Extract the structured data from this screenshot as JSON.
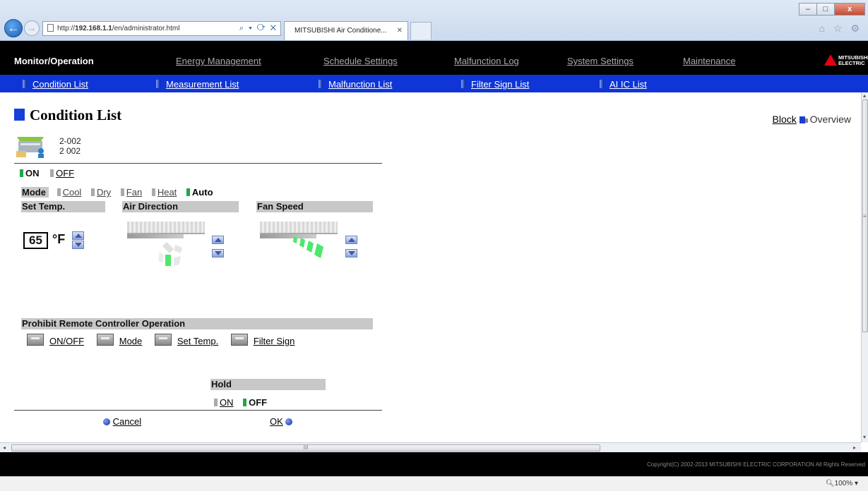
{
  "browser": {
    "url_prefix": "http://",
    "url_host": "192.168.1.1",
    "url_path": "/en/administrator.html",
    "address_tools": "⌕ ▾ ⟳ ✕",
    "tab_title": "MITSUBISHI Air Conditione...",
    "tab_close": "✕",
    "back_glyph": "←",
    "forward_glyph": "→",
    "minimize": "–",
    "maximize": "□",
    "close": "x",
    "right_icons": "⌂ ☆ ⚙",
    "zoom": "100%",
    "zoom_dropdown": "▾"
  },
  "topnav": {
    "monitor": "Monitor/Operation",
    "energy": "Energy Management",
    "schedule": "Schedule Settings",
    "malfunction_log": "Malfunction Log",
    "system": "System Settings",
    "maintenance": "Maintenance",
    "logo_line1": "MITSUBISHI",
    "logo_line2": "ELECTRIC"
  },
  "subnav": {
    "condition": "Condition List",
    "measurement": "Measurement List",
    "malfunction": "Malfunction List",
    "filter": "Filter Sign List",
    "aic": "AI IC List"
  },
  "page": {
    "title": "Condition List",
    "view_block": "Block",
    "view_overview": "Overview",
    "unit_name_1": "2-002",
    "unit_name_2": "2 002"
  },
  "power": {
    "on": "ON",
    "off": "OFF",
    "selected": "ON"
  },
  "mode": {
    "label": "Mode",
    "options": [
      "Cool",
      "Dry",
      "Fan",
      "Heat",
      "Auto"
    ],
    "selected": "Auto"
  },
  "sections": {
    "set_temp": "Set Temp.",
    "air_direction": "Air Direction",
    "fan_speed": "Fan Speed",
    "prohibit": "Prohibit Remote Controller Operation",
    "hold": "Hold"
  },
  "set_temp": {
    "value": "65",
    "unit": "°F"
  },
  "prohibit_buttons": [
    "ON/OFF",
    "Mode",
    "Set Temp.",
    "Filter Sign"
  ],
  "hold": {
    "on": "ON",
    "off": "OFF",
    "selected": "OFF"
  },
  "footer": {
    "cancel": "Cancel",
    "ok": "OK"
  },
  "copyright": "Copyright(C) 2002-2013 MITSUBISHI ELECTRIC CORPORATION All Rights Reserved",
  "scroll": {
    "hthumb_glyph": "III",
    "left": "◂",
    "right": "▸",
    "up": "▴",
    "down": "▾",
    "vgrip": "≡"
  },
  "colors": {
    "nav_bg": "#000000",
    "subnav_bg": "#0f35d6",
    "accent_blue": "#1740d8",
    "on_green": "#1ea84a",
    "logo_red": "#e60012"
  }
}
